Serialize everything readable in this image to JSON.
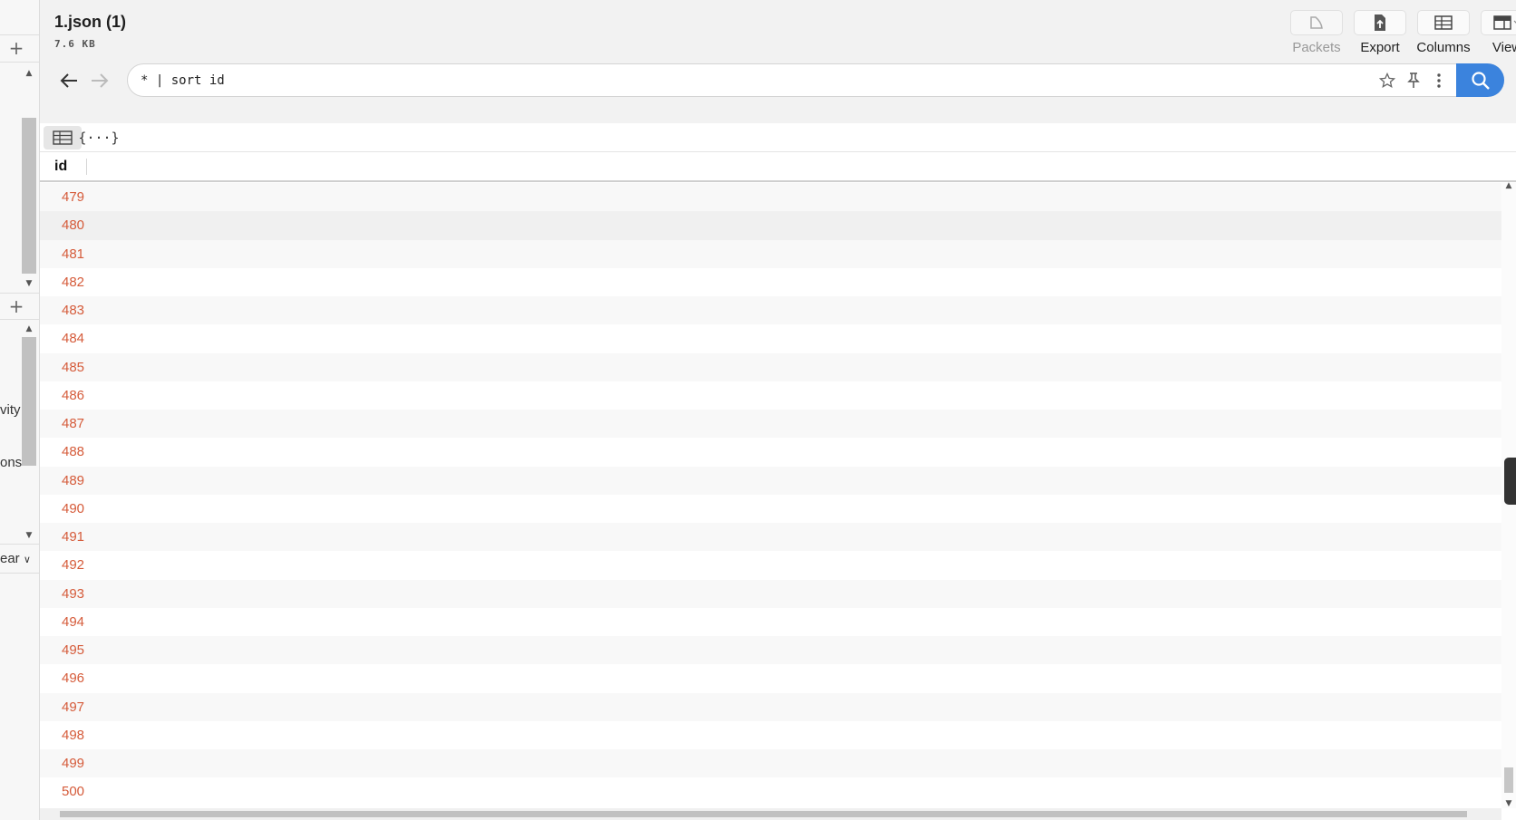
{
  "file": {
    "title": "1.json (1)",
    "size": "7.6 KB"
  },
  "toolbar": {
    "packets_label": "Packets",
    "export_label": "Export",
    "columns_label": "Columns",
    "view_label": "View"
  },
  "search": {
    "query": "* | sort id"
  },
  "sidebar": {
    "label_activity": "vity",
    "label_options": "ons",
    "label_clear": "ear"
  },
  "table": {
    "columns": [
      "id"
    ],
    "rows": [
      "479",
      "480",
      "481",
      "482",
      "483",
      "484",
      "485",
      "486",
      "487",
      "488",
      "489",
      "490",
      "491",
      "492",
      "493",
      "494",
      "495",
      "496",
      "497",
      "498",
      "499",
      "500"
    ],
    "hovered_row": "480"
  },
  "colors": {
    "id_value": "#d55b3a",
    "search_button": "#3b83dd"
  },
  "icons": {
    "back": "arrow-left-icon",
    "forward": "arrow-right-icon",
    "star": "star-icon",
    "pin": "pin-icon",
    "more": "more-vertical-icon",
    "search": "search-icon",
    "table_view": "table-icon",
    "json_view": "json-braces-icon"
  }
}
